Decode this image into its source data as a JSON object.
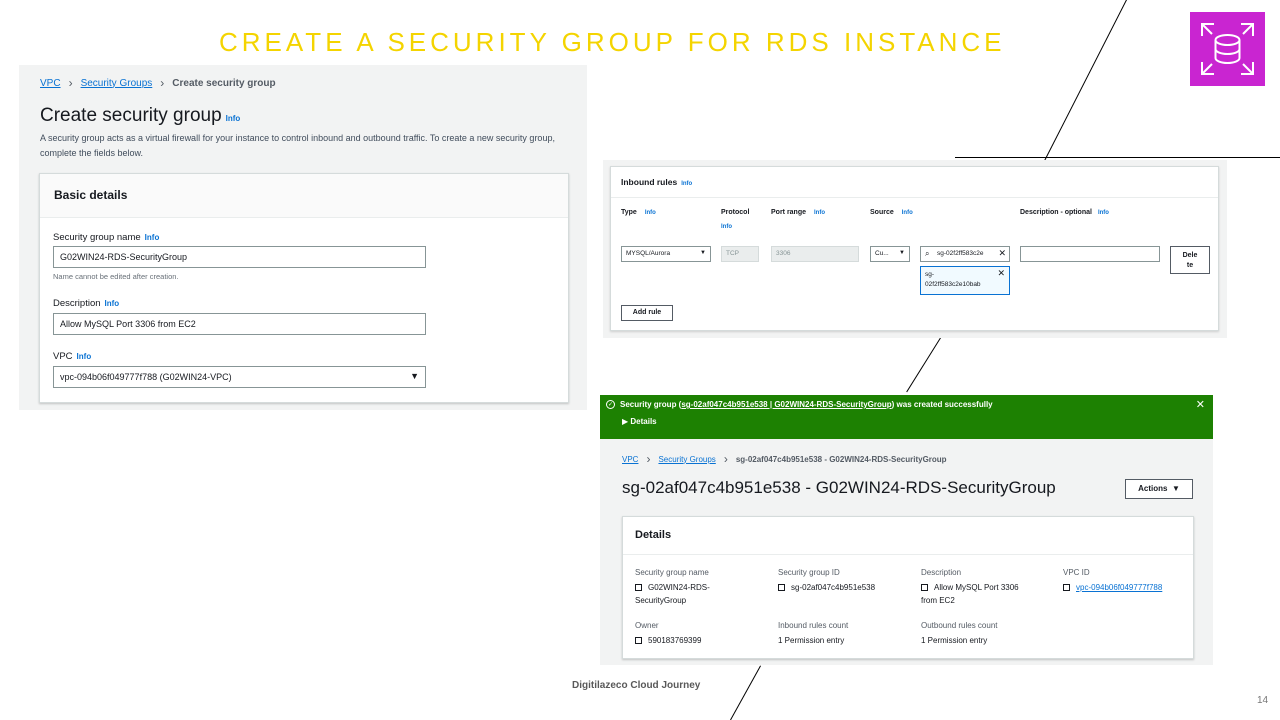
{
  "slide": {
    "title": "CREATE A SECURITY GROUP FOR RDS INSTANCE",
    "footer": "Digitilazeco Cloud Journey",
    "page_number": "14",
    "logo": "rds-database-icon",
    "title_color": "#f4d400",
    "logo_color": "#c925d1"
  },
  "create_form": {
    "breadcrumb": [
      "VPC",
      "Security Groups",
      "Create security group"
    ],
    "heading": "Create security group",
    "info": "Info",
    "description": "A security group acts as a virtual firewall for your instance to control inbound and outbound traffic. To create a new security group, complete the fields below.",
    "basic_details": {
      "title": "Basic details",
      "name_label": "Security group name",
      "name_value": "G02WIN24-RDS-SecurityGroup",
      "name_hint": "Name cannot be edited after creation.",
      "desc_label": "Description",
      "desc_value": "Allow MySQL Port 3306 from EC2",
      "vpc_label": "VPC",
      "vpc_value": "vpc-094b06f049777f788 (G02WIN24-VPC)"
    }
  },
  "inbound": {
    "title": "Inbound rules",
    "info": "Info",
    "headers": {
      "type": "Type",
      "protocol": "Protocol",
      "port_range": "Port range",
      "source": "Source",
      "description": "Description - optional"
    },
    "row": {
      "type": "MYSQL/Aurora",
      "protocol": "TCP",
      "port": "3306",
      "source_type": "Cu...",
      "source_search": "sg-02f2ff583c2e",
      "source_token_line1": "sg-",
      "source_token_line2": "02f2ff583c2e10bab",
      "description": "",
      "delete_line1": "Dele",
      "delete_line2": "te"
    },
    "add_rule": "Add rule"
  },
  "result": {
    "flash": {
      "prefix": "Security group (",
      "link": "sg-02af047c4b951e538 | G02WIN24-RDS-SecurityGroup",
      "suffix": ") was created successfully",
      "details": "Details",
      "color": "#1d8102"
    },
    "breadcrumb": [
      "VPC",
      "Security Groups",
      "sg-02af047c4b951e538 - G02WIN24-RDS-SecurityGroup"
    ],
    "title": "sg-02af047c4b951e538 - G02WIN24-RDS-SecurityGroup",
    "actions": "Actions",
    "details": {
      "title": "Details",
      "sg_name_label": "Security group name",
      "sg_name_line1": "G02WIN24-RDS-",
      "sg_name_line2": "SecurityGroup",
      "sg_id_label": "Security group ID",
      "sg_id_value": "sg-02af047c4b951e538",
      "desc_label": "Description",
      "desc_line1": "Allow MySQL Port 3306",
      "desc_line2": "from EC2",
      "vpc_label": "VPC ID",
      "vpc_value": "vpc-094b06f049777f788",
      "owner_label": "Owner",
      "owner_value": "590183769399",
      "inbound_label": "Inbound rules count",
      "inbound_value": "1 Permission entry",
      "outbound_label": "Outbound rules count",
      "outbound_value": "1 Permission entry"
    }
  }
}
